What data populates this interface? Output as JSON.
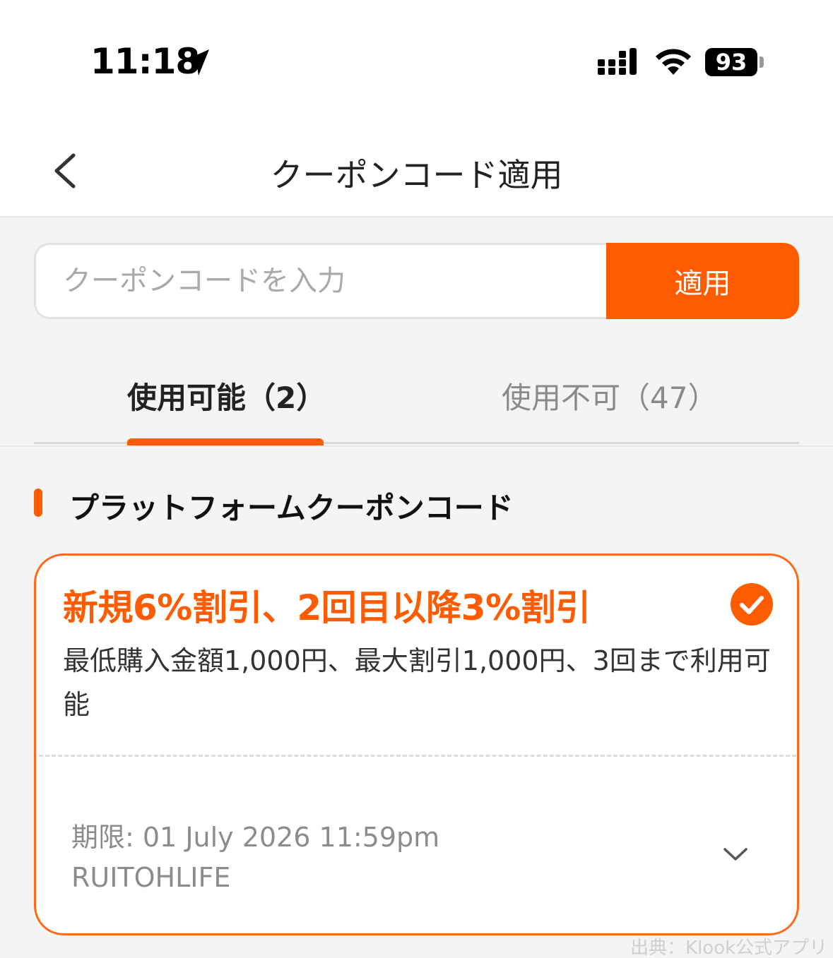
{
  "status_bar": {
    "time": "11:18",
    "battery": "93"
  },
  "header": {
    "title": "クーポンコード適用"
  },
  "coupon_input": {
    "placeholder": "クーポンコードを入力",
    "value": "",
    "apply_label": "適用"
  },
  "tabs": [
    {
      "label": "使用可能（2）",
      "active": true
    },
    {
      "label": "使用不可（47）",
      "active": false
    }
  ],
  "section": {
    "title": "プラットフォームクーポンコード"
  },
  "coupon": {
    "title": "新規6%割引、2回目以降3%割引",
    "description": "最低購入金額1,000円、最大割引1,000円、3回まで利用可能",
    "expiry": "期限: 01 July 2026 11:59pm",
    "code": "RUITOHLIFE",
    "selected": true
  },
  "credit": "出典：Klook公式アプリ",
  "colors": {
    "accent": "#ff5b00",
    "background": "#f4f4f4",
    "muted_text": "#8c8c8c"
  }
}
